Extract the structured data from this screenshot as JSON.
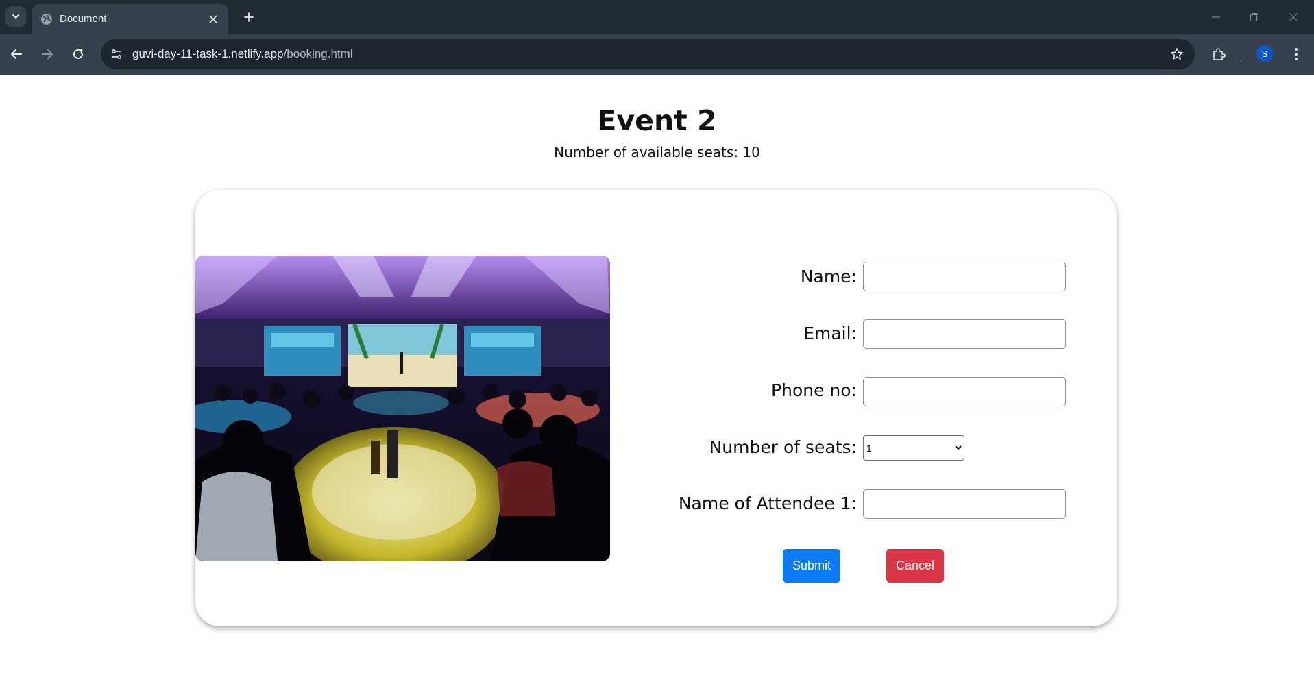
{
  "browser": {
    "tab_title": "Document",
    "url_host": "guvi-day-11-task-1.netlify.app",
    "url_path": "/booking.html",
    "profile_initial": "S"
  },
  "page": {
    "title": "Event 2",
    "seats_available": "Number of available seats: 10"
  },
  "form": {
    "name_label": "Name:",
    "email_label": "Email:",
    "phone_label": "Phone no:",
    "seats_label": "Number of seats:",
    "seats_selected": "1",
    "attendee_label": "Name of Attendee 1:",
    "submit_label": "Submit",
    "cancel_label": "Cancel"
  },
  "colors": {
    "submit": "#0d7bf7",
    "cancel": "#dc3545",
    "chrome_dark": "#202a33",
    "chrome_toolbar": "#35414c"
  }
}
